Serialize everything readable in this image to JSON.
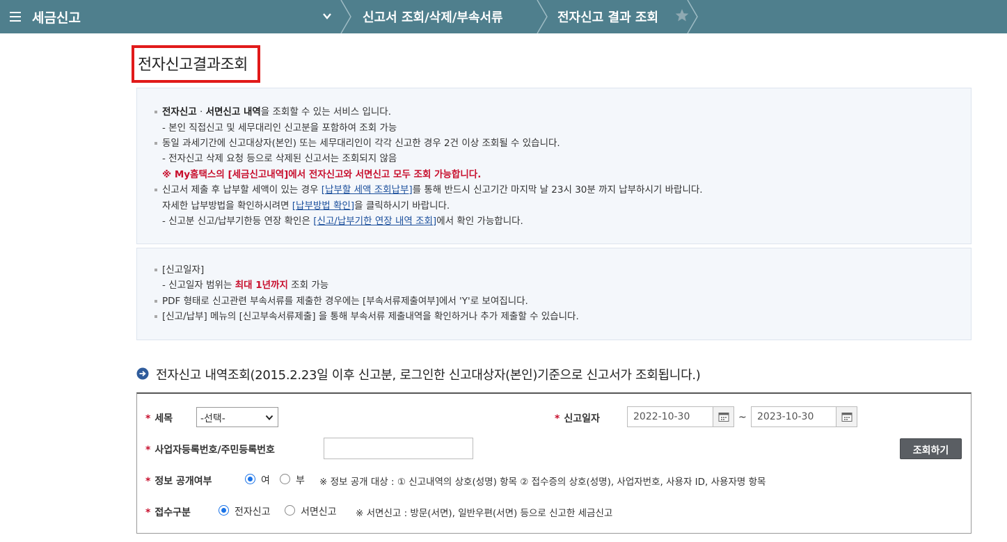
{
  "topbar": {
    "app_title": "세금신고",
    "breadcrumb": [
      "신고서 조회/삭제/부속서류",
      "전자신고 결과 조회"
    ]
  },
  "page_title": "전자신고결과조회",
  "info1": {
    "l1_b1": "전자신고",
    "l1_dot": " · ",
    "l1_b2": "서면신고 내역",
    "l1_rest": "을 조회할 수 있는 서비스 입니다.",
    "l2": "- 본인 직접신고 및 세무대리인 신고분을 포함하여 조회 가능",
    "l3": "동일 과세기간에 신고대상자(본인) 또는 세무대리인이 각각 신고한 경우 2건 이상 조회될 수 있습니다.",
    "l4": "- 전자신고 삭제 요청 등으로 삭제된 신고서는 조회되지 않음",
    "l5": "※ My홈택스의 [세금신고내역]에서 전자신고와 서면신고 모두 조회 가능합니다.",
    "l6_pre": "신고서 제출 후 납부할 세액이 있는 경우 ",
    "l6_link": "[납부할 세액 조회납부]",
    "l6_post": "를 통해 반드시 신고기간 마지막 날 23시 30분 까지 납부하시기 바랍니다.",
    "l7_pre": "자세한 납부방법을 확인하시려면 ",
    "l7_link": "[납부방법 확인]",
    "l7_post": "을 클릭하시기 바랍니다.",
    "l8_pre": "- 신고분 신고/납부기한등 연장 확인은 ",
    "l8_link": "[신고/납부기한 연장 내역 조회]",
    "l8_post": "에서 확인 가능합니다."
  },
  "info2": {
    "l1": "[신고일자]",
    "l2_pre": "- 신고일자 범위는 ",
    "l2_red": "최대 1년까지",
    "l2_post": " 조회 가능",
    "l3": "PDF 형태로 신고관련 부속서류를 제출한 경우에는 [부속서류제출여부]에서 'Y'로 보여집니다.",
    "l4": "[신고/납부] 메뉴의 [신고부속서류제출] 을 통해 부속서류 제출내역을 확인하거나 추가 제출할 수 있습니다."
  },
  "section_title": "전자신고 내역조회(2015.2.23일 이후 신고분, 로그인한  신고대상자(본인)기준으로  신고서가 조회됩니다.)",
  "form": {
    "required_mark": "*",
    "tax_item_label": "세목",
    "tax_item_value": "-선택-",
    "date_label": "신고일자",
    "date_from": "2022-10-30",
    "date_sep": "~",
    "date_to": "2023-10-30",
    "reg_label": "사업자등록번호/주민등록번호",
    "reg_value": "",
    "search_button": "조회하기",
    "disclosure_label": "정보 공개여부",
    "disclosure_yes": "여",
    "disclosure_no": "부",
    "disclosure_note": "※ 정보 공개 대상 : ① 신고내역의 상호(성명) 항목 ② 접수증의 상호(성명), 사업자번호, 사용자 ID, 사용자명 항목",
    "receipt_label": "접수구분",
    "receipt_electronic": "전자신고",
    "receipt_paper": "서면신고",
    "receipt_note": "※ 서면신고 : 방문(서면), 일반우편(서면) 등으로 신고한 세금신고"
  },
  "colors": {
    "topbar": "#4f7f8d",
    "required": "#c8102e",
    "link": "#1b4f9c",
    "highlight_box": "#e11a1a"
  },
  "icons": [
    "menu-icon",
    "chevron-down-icon",
    "star-icon",
    "arrow-right-circle-icon",
    "calendar-icon"
  ]
}
